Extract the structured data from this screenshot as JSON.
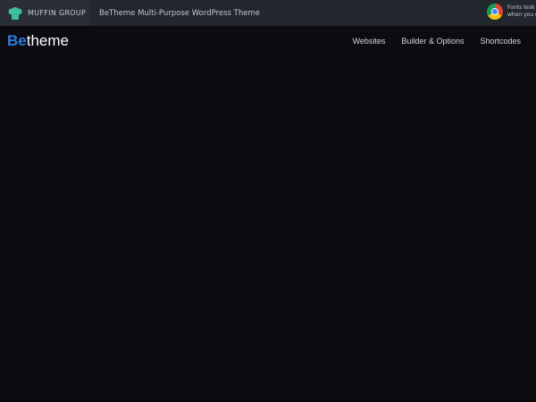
{
  "topbar": {
    "brand": "MUFFIN GROUP",
    "product": "BeTheme Multi-Purpose WordPress Theme",
    "notice_line1": "Fonts look",
    "notice_line2": "when you c"
  },
  "header": {
    "logo_be": "Be",
    "logo_theme": "theme",
    "menu": [
      "Websites",
      "Builder & Options",
      "Shortcodes"
    ]
  },
  "colors": {
    "accent": "#2f7fe0",
    "brand_icon": "#3fbf9b"
  }
}
